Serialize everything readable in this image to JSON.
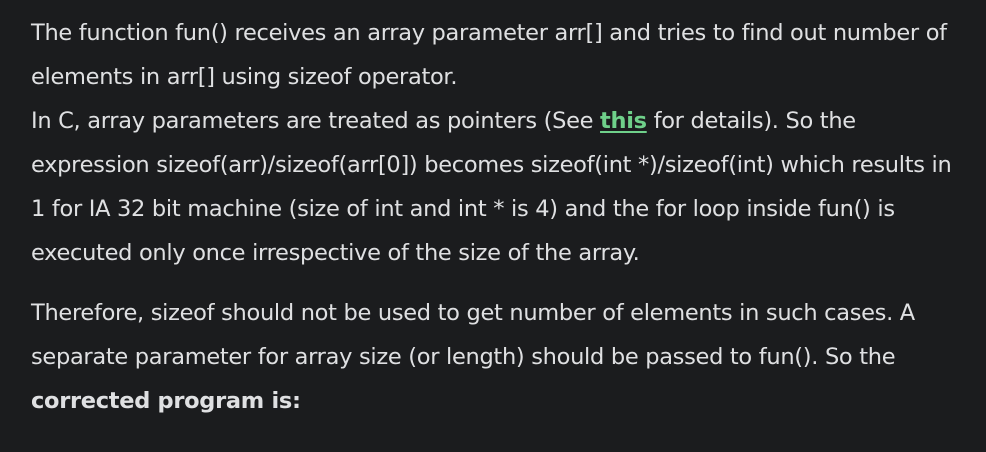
{
  "article": {
    "line1": "The function fun() receives an array parameter arr[] and tries to find out number of elements in arr[] using sizeof operator.",
    "para1_pre": "In C, array parameters are treated as pointers (See ",
    "para1_link": "this",
    "para1_post": " for details). So the expression sizeof(arr)/sizeof(arr[0]) becomes sizeof(int *)/sizeof(int) which results in 1 for IA 32 bit machine (size of int and int * is 4) and the for loop inside fun() is executed only once irrespective of the size of the array.",
    "para2_pre": "Therefore, sizeof should not be used to get number of elements in such cases. A separate parameter for array size (or length) should be passed to fun(). So the ",
    "para2_bold": "corrected program is:"
  },
  "colors": {
    "background": "#1b1c1e",
    "text": "#dfe0e2",
    "link": "#6fd08a"
  }
}
